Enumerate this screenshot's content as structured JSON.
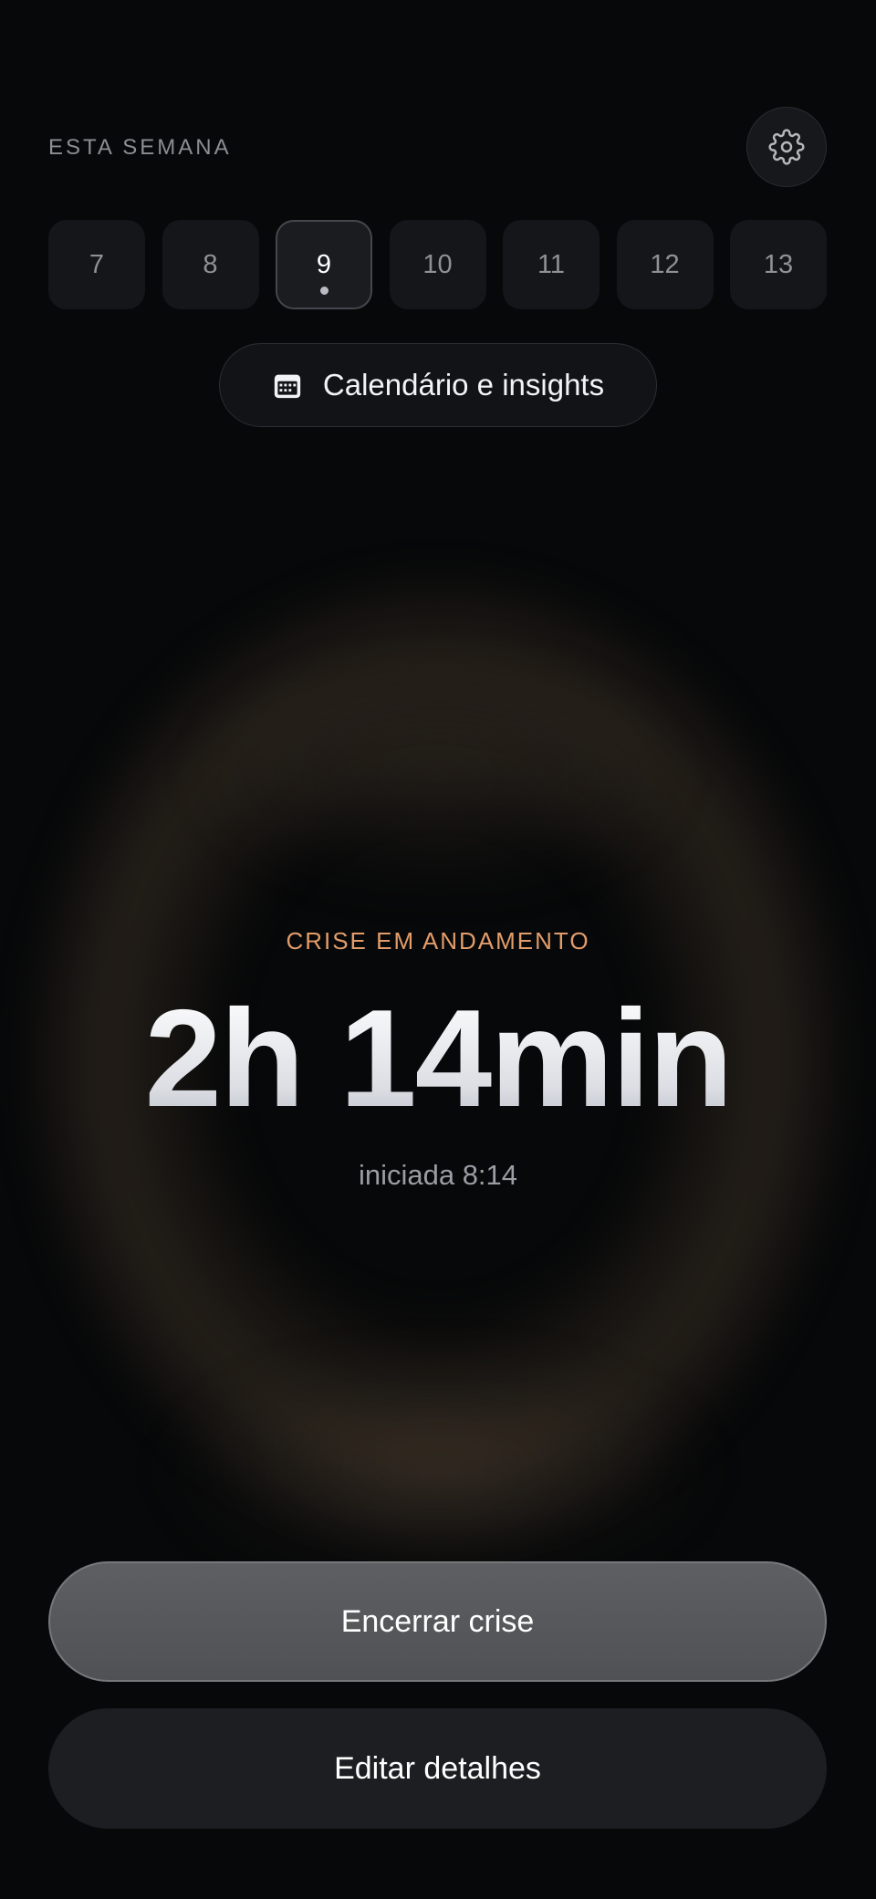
{
  "header": {
    "week_label": "ESTA SEMANA",
    "settings_icon": "gear-icon"
  },
  "days": [
    {
      "label": "7",
      "selected": false,
      "has_event": false
    },
    {
      "label": "8",
      "selected": false,
      "has_event": false
    },
    {
      "label": "9",
      "selected": true,
      "has_event": true
    },
    {
      "label": "10",
      "selected": false,
      "has_event": false
    },
    {
      "label": "11",
      "selected": false,
      "has_event": false
    },
    {
      "label": "12",
      "selected": false,
      "has_event": false
    },
    {
      "label": "13",
      "selected": false,
      "has_event": false
    }
  ],
  "calendar_button": {
    "icon": "calendar-icon",
    "label": "Calendário e insights"
  },
  "crisis": {
    "status": "CRISE EM ANDAMENTO",
    "duration": "2h 14min",
    "started": "iniciada 8:14"
  },
  "actions": {
    "end_label": "Encerrar crise",
    "edit_label": "Editar detalhes"
  },
  "colors": {
    "background": "#070809",
    "accent": "#e39c6a",
    "glow": "#786046"
  }
}
